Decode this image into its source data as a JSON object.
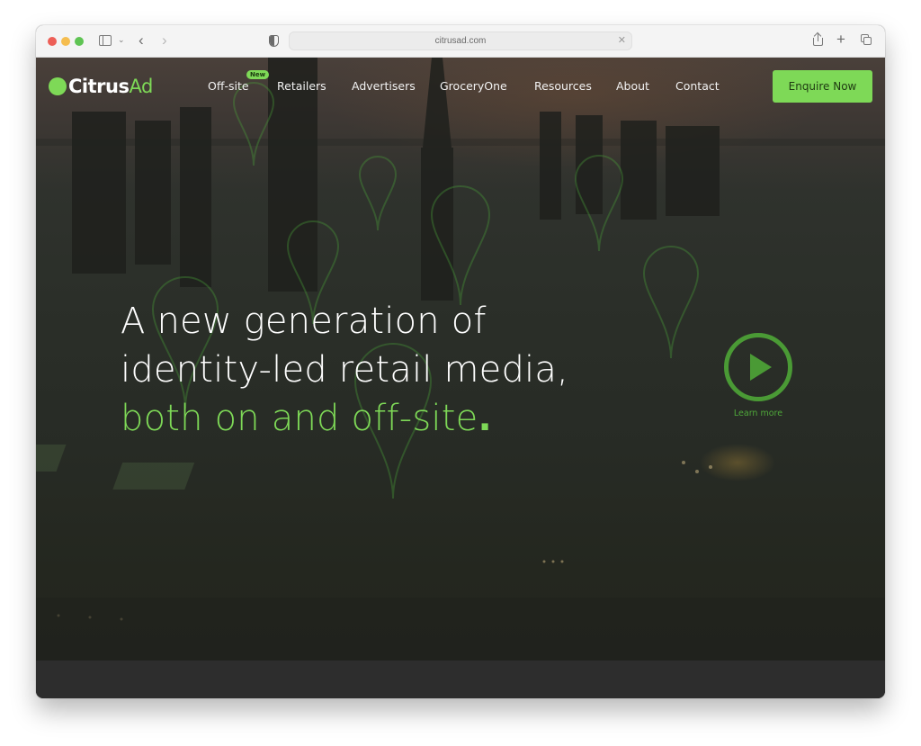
{
  "browser": {
    "url": "citrusad.com",
    "icons": [
      "sidebar-icon",
      "chevron-down-icon",
      "back-icon",
      "forward-icon",
      "privacy-shield-icon",
      "clear-url-icon",
      "share-icon",
      "new-tab-icon",
      "tab-overview-icon"
    ]
  },
  "site": {
    "logo": {
      "primary": "Citrus",
      "secondary": "Ad"
    },
    "nav": {
      "items": [
        {
          "label": "Off-site",
          "badge": "New"
        },
        {
          "label": "Retailers"
        },
        {
          "label": "Advertisers"
        },
        {
          "label": "GroceryOne"
        },
        {
          "label": "Resources"
        },
        {
          "label": "About"
        },
        {
          "label": "Contact"
        }
      ],
      "cta": "Enquire Now"
    },
    "hero": {
      "line1": "A new generation of",
      "line2": "identity-led retail media,",
      "line3": "both on and off-site",
      "line3_dot": ".",
      "video_link": "Learn more"
    }
  },
  "colors": {
    "brand_green": "#7ed957",
    "play_green": "#4a9a35",
    "hero_dark": "#272b25"
  }
}
